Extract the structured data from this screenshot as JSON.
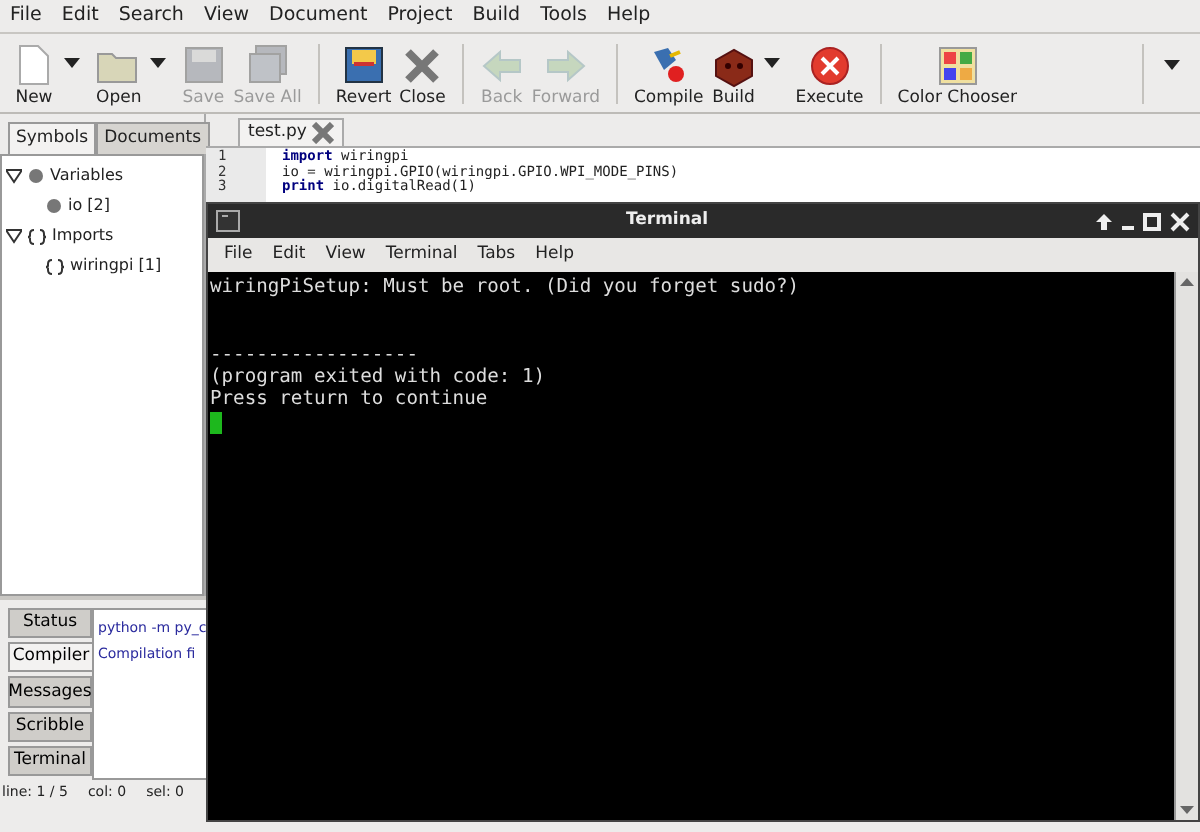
{
  "menu": [
    "File",
    "Edit",
    "Search",
    "View",
    "Document",
    "Project",
    "Build",
    "Tools",
    "Help"
  ],
  "toolbar": [
    {
      "label": "New",
      "disabled": false,
      "dropdown": true
    },
    {
      "label": "Open",
      "disabled": false,
      "dropdown": true
    },
    {
      "label": "Save",
      "disabled": true,
      "dropdown": false
    },
    {
      "label": "Save All",
      "disabled": true,
      "dropdown": false
    },
    {
      "label": "Revert",
      "disabled": false,
      "dropdown": false
    },
    {
      "label": "Close",
      "disabled": false,
      "dropdown": false
    },
    {
      "label": "Back",
      "disabled": true,
      "dropdown": false
    },
    {
      "label": "Forward",
      "disabled": true,
      "dropdown": false
    },
    {
      "label": "Compile",
      "disabled": false,
      "dropdown": false
    },
    {
      "label": "Build",
      "disabled": false,
      "dropdown": true
    },
    {
      "label": "Execute",
      "disabled": false,
      "dropdown": false
    },
    {
      "label": "Color Chooser",
      "disabled": false,
      "dropdown": false
    }
  ],
  "sidebar": {
    "tabs": [
      {
        "label": "Symbols",
        "selected": true
      },
      {
        "label": "Documents",
        "selected": false
      }
    ],
    "tree": [
      {
        "label": "Variables",
        "expanded": true,
        "children": [
          {
            "label": "io [2]"
          }
        ]
      },
      {
        "label": "Imports",
        "expanded": true,
        "children": [
          {
            "label": "wiringpi [1]"
          }
        ]
      }
    ]
  },
  "editor": {
    "tabs": [
      {
        "label": "test.py",
        "selected": true
      }
    ],
    "lines": [
      {
        "number": "1",
        "code": "**import** wiringpi"
      },
      {
        "number": "2",
        "code": "io = wiringpi.GPIO(wiringpi.GPIO.WPI_MODE_PINS)"
      },
      {
        "number": "3",
        "code": "**print** io.digitalRead(1)"
      }
    ]
  },
  "messages": {
    "tabs": [
      {
        "label": "Status",
        "selected": false
      },
      {
        "label": "Compiler",
        "selected": true
      },
      {
        "label": "Messages",
        "selected": false
      },
      {
        "label": "Scribble",
        "selected": false
      },
      {
        "label": "Terminal",
        "selected": false
      }
    ],
    "lines": [
      "python -m py_c",
      "Compilation fi"
    ]
  },
  "status_bar": [
    "line: 1 / 5",
    "col: 0",
    "sel: 0"
  ],
  "terminal": {
    "title": "Terminal",
    "menu": [
      "File",
      "Edit",
      "View",
      "Terminal",
      "Tabs",
      "Help"
    ],
    "lines": [
      "wiringPiSetup: Must be root. (Did you forget sudo?)",
      "------------------",
      "(program exited with code: 1)",
      "Press return to continue"
    ]
  }
}
